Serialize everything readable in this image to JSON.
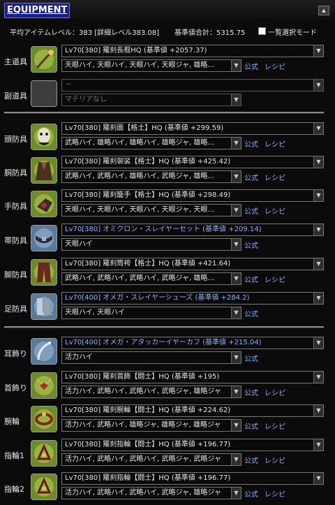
{
  "header": {
    "title": "EQUIPMENT",
    "collapse_icon": "▲"
  },
  "stats": {
    "avg_item_level": "平均アイテムレベル：383 [詳細レベル383.08]",
    "base_total": "基準値合計：5315.75",
    "list_select_mode": "一覧選択モード",
    "list_select_checked": false
  },
  "links": {
    "formula": "公式",
    "recipe": "レシピ"
  },
  "slots": [
    {
      "label": "主道具",
      "item": "Lv70[380] 羅刹長棍HQ (基準値 +2057.37)",
      "materia": "天眼ハイ, 天眼ハイ, 天眼ハイ, 天眼ジャ, 雄略…",
      "style": "normal",
      "icon": "staff-icon",
      "recipe": true
    },
    {
      "label": "副道具",
      "item": "－",
      "materia": "マテリアなし",
      "style": "empty",
      "icon": "empty-slot-icon",
      "recipe": false
    },
    {
      "label": "頭防具",
      "item": "Lv70[380] 羅刹面【格士】HQ (基準値 +299.59)",
      "materia": "武略ハイ, 雄略ハイ, 雄略ハイ, 雄略ジャ, 雄略…",
      "style": "normal",
      "icon": "mask-icon",
      "recipe": true
    },
    {
      "label": "胴防具",
      "item": "Lv70[380] 羅刹袈裟【格士】HQ (基準値 +425.42)",
      "materia": "武略ハイ, 武略ハイ, 雄略ハイ, 武略ジャ, 雄略…",
      "style": "normal",
      "icon": "robe-icon",
      "recipe": true
    },
    {
      "label": "手防具",
      "item": "Lv70[380] 羅刹籠手【格士】HQ (基準値 +298.49)",
      "materia": "天眼ハイ, 天眼ハイ, 天眼ハイ, 天眼ジャ, 天眼…",
      "style": "normal",
      "icon": "gauntlet-icon",
      "recipe": true
    },
    {
      "label": "帯防具",
      "item": "Lv70[380] オミクロン・スレイヤーセット (基準値 +209.14)",
      "materia": "天眼ハイ",
      "style": "blue",
      "icon": "belt-icon",
      "recipe": false
    },
    {
      "label": "脚防具",
      "item": "Lv70[380] 羅刹筒袴【格士】HQ (基準値 +421.64)",
      "materia": "武略ハイ, 武略ハイ, 武略ハイ, 武略ジャ, 雄略…",
      "style": "normal",
      "icon": "pants-icon",
      "recipe": true
    },
    {
      "label": "足防具",
      "item": "Lv70[400] オメガ・スレイヤーシューズ (基準値 +284.2)",
      "materia": "天眼ハイ, 天眼ハイ",
      "style": "blue",
      "icon": "boots-icon",
      "recipe": false
    },
    {
      "label": "耳飾り",
      "item": "Lv70[400] オメガ・アタッカーイヤーカフ (基準値 +215.04)",
      "materia": "活力ハイ",
      "style": "blue",
      "icon": "earring-icon",
      "recipe": false
    },
    {
      "label": "首飾り",
      "item": "Lv70[380] 羅刹首飾【闘士】HQ (基準値 +195)",
      "materia": "活力ハイ, 武略ハイ, 武略ハイ, 武略ジャ, 雄略ジャ",
      "style": "normal",
      "icon": "necklace-icon",
      "recipe": true
    },
    {
      "label": "腕輪",
      "item": "Lv70[380] 羅刹腕輪【闘士】HQ (基準値 +224.62)",
      "materia": "活力ハイ, 武略ハイ, 雄略ジャ, 雄略ジャ, 雄略ジャ",
      "style": "normal",
      "icon": "bracelet-icon",
      "recipe": true
    },
    {
      "label": "指輪1",
      "item": "Lv70[380] 羅刹指輪【闘士】HQ (基準値 +196.77)",
      "materia": "活力ハイ, 武略ハイ, 武略ハイ, 武略ジャ, 武略ジャ",
      "style": "normal",
      "icon": "ring-icon",
      "recipe": true
    },
    {
      "label": "指輪2",
      "item": "Lv70[380] 羅刹指輪【闘士】HQ (基準値 +196.77)",
      "materia": "活力ハイ, 武略ハイ, 武略ハイ, 武略ジャ, 雄略ジャ",
      "style": "normal",
      "icon": "ring-icon",
      "recipe": true
    }
  ]
}
